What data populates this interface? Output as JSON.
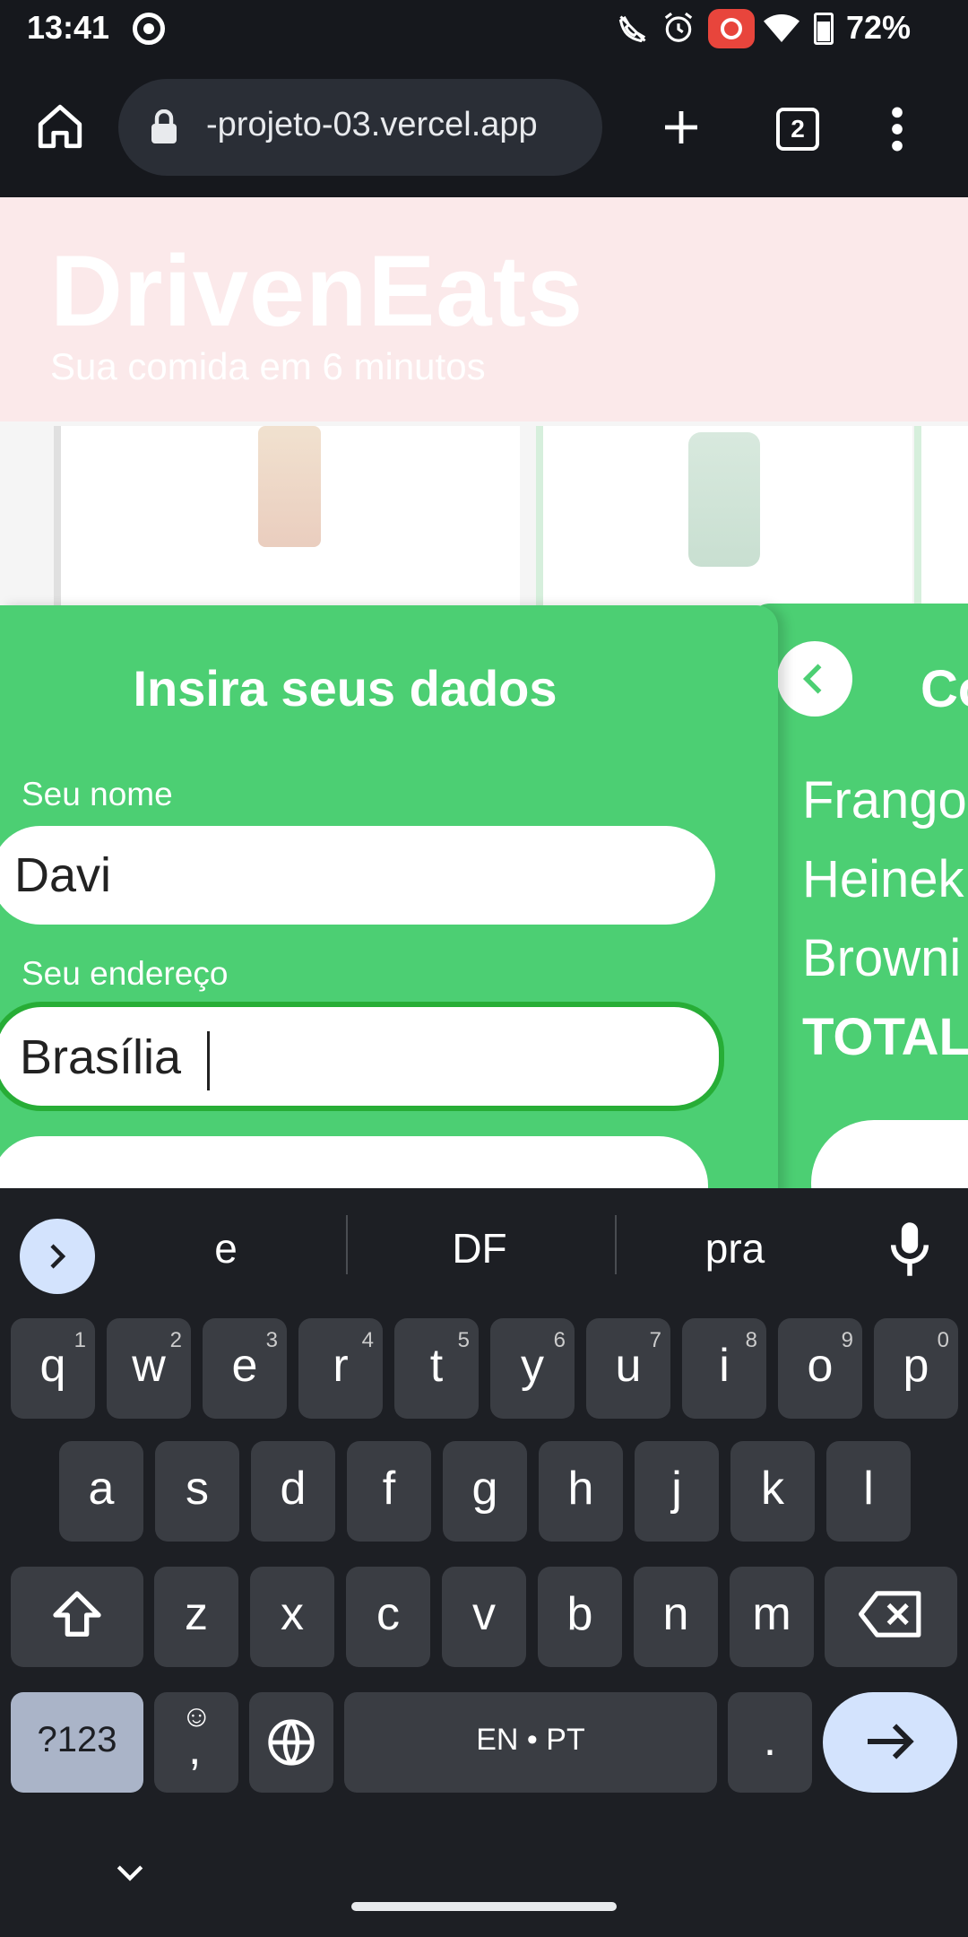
{
  "status_bar": {
    "time": "13:41",
    "battery": "72%"
  },
  "browser": {
    "url": "-projeto-03.vercel.app",
    "tab_count": "2"
  },
  "header": {
    "brand": "DrivenEats",
    "tagline": "Sua comida em 6 minutos"
  },
  "form": {
    "title": "Insira seus dados",
    "name_label": "Seu nome",
    "name_value": "Davi",
    "address_label": "Seu endereço",
    "address_value": "Brasília"
  },
  "summary": {
    "title_fragment": "Co",
    "items": [
      "Frango",
      "Heinek",
      "Browni"
    ],
    "total_label": "TOTAL"
  },
  "keyboard": {
    "suggestions": [
      "e",
      "DF",
      "pra"
    ],
    "row1": [
      {
        "key": "q",
        "hint": "1"
      },
      {
        "key": "w",
        "hint": "2"
      },
      {
        "key": "e",
        "hint": "3"
      },
      {
        "key": "r",
        "hint": "4"
      },
      {
        "key": "t",
        "hint": "5"
      },
      {
        "key": "y",
        "hint": "6"
      },
      {
        "key": "u",
        "hint": "7"
      },
      {
        "key": "i",
        "hint": "8"
      },
      {
        "key": "o",
        "hint": "9"
      },
      {
        "key": "p",
        "hint": "0"
      }
    ],
    "row2": [
      "a",
      "s",
      "d",
      "f",
      "g",
      "h",
      "j",
      "k",
      "l"
    ],
    "row3": [
      "z",
      "x",
      "c",
      "v",
      "b",
      "n",
      "m"
    ],
    "symbols_label": "?123",
    "comma_label": ",",
    "space_label": "EN • PT",
    "period_label": "."
  },
  "colors": {
    "accent": "#4ccf73",
    "keyboard_bg": "#1d1f24",
    "key_bg": "#3a3d43"
  }
}
